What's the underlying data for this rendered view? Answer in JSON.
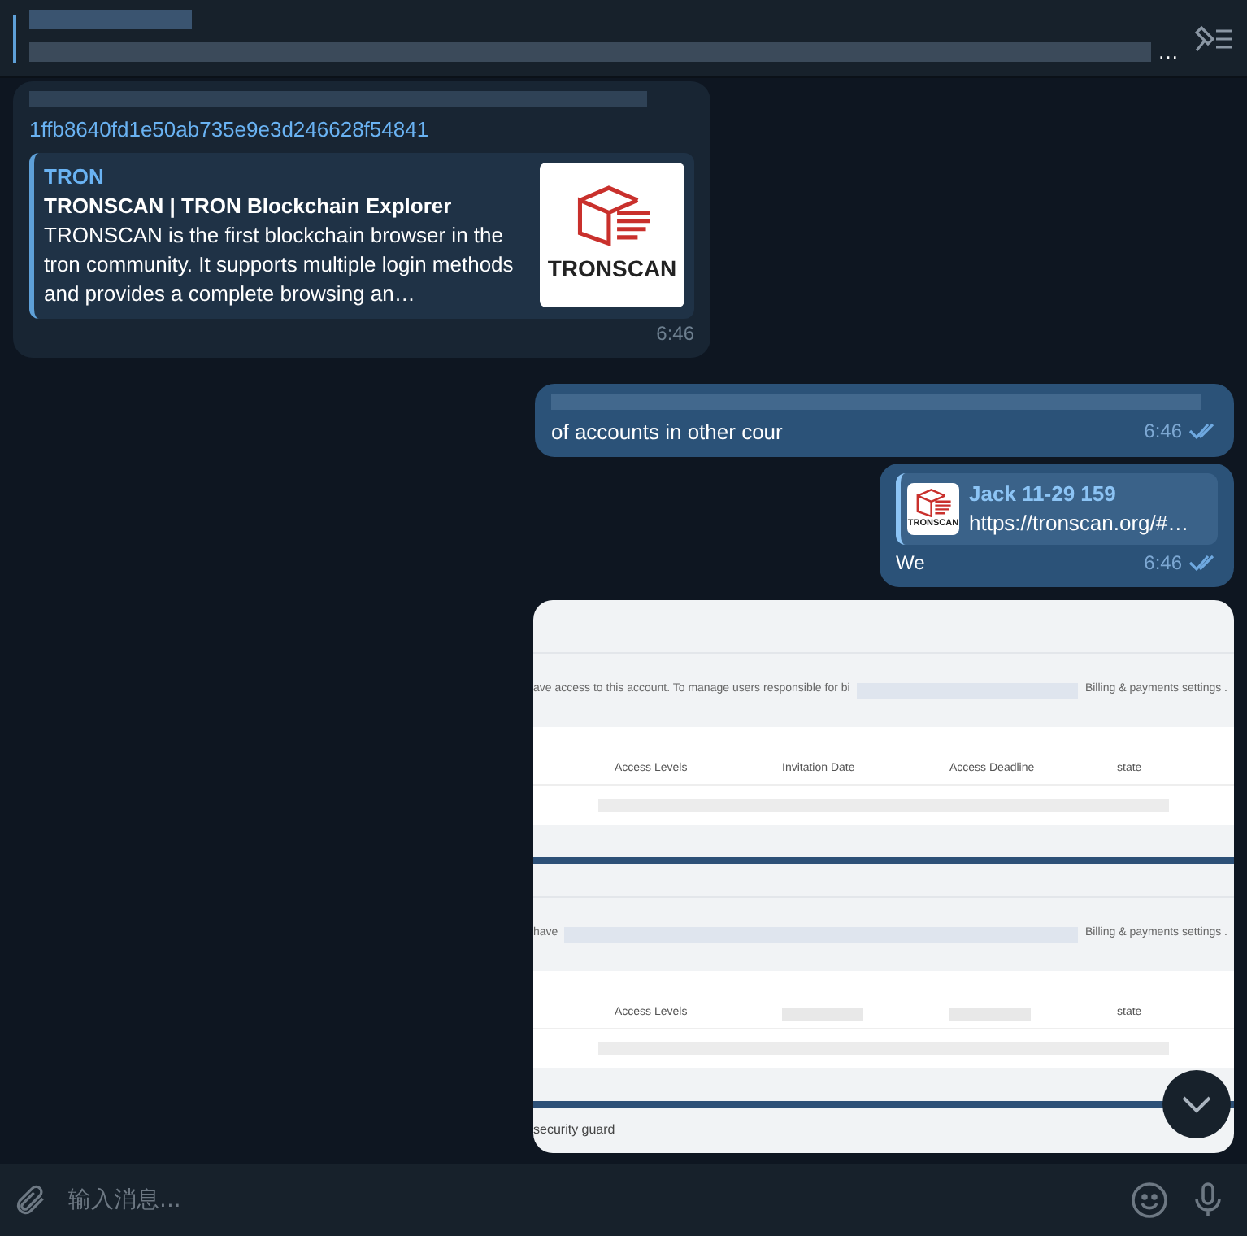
{
  "pinned_message": {
    "text": "…"
  },
  "messages": [
    {
      "kind": "link",
      "outgoing": false,
      "link_text": "1ffb8640fd1e50ab735e9e3d246628f54841",
      "preview": {
        "site": "TRON",
        "title": "TRONSCAN | TRON Blockchain Explorer",
        "description": "TRONSCAN is the first blockchain browser in the tron community. It supports multiple login methods and provides a complete browsing an…",
        "logo_text": "TRONSCAN"
      },
      "time": "6:46"
    },
    {
      "kind": "text",
      "outgoing": true,
      "text": "of accounts in other cour",
      "time": "6:46",
      "read": true
    },
    {
      "kind": "reply",
      "outgoing": true,
      "reply": {
        "author": "Jack 11-29 159",
        "text": "https://tronscan.org/#…",
        "logo_text": "TRONSCAN"
      },
      "text": "We",
      "time": "6:46",
      "read": true
    },
    {
      "kind": "screenshot",
      "outgoing": true,
      "sections": [
        {
          "notice": "ave access to this account. To manage users responsible for bi",
          "notice_tail": "Billing & payments settings .",
          "columns": [
            "Access Levels",
            "Invitation Date",
            "Access Deadline",
            "state"
          ]
        },
        {
          "notice": "have",
          "notice_tail": "Billing & payments settings .",
          "columns": [
            "Access Levels",
            "",
            "",
            "state"
          ]
        }
      ],
      "footer": "security guard"
    }
  ],
  "composer": {
    "placeholder": "输入消息..."
  }
}
